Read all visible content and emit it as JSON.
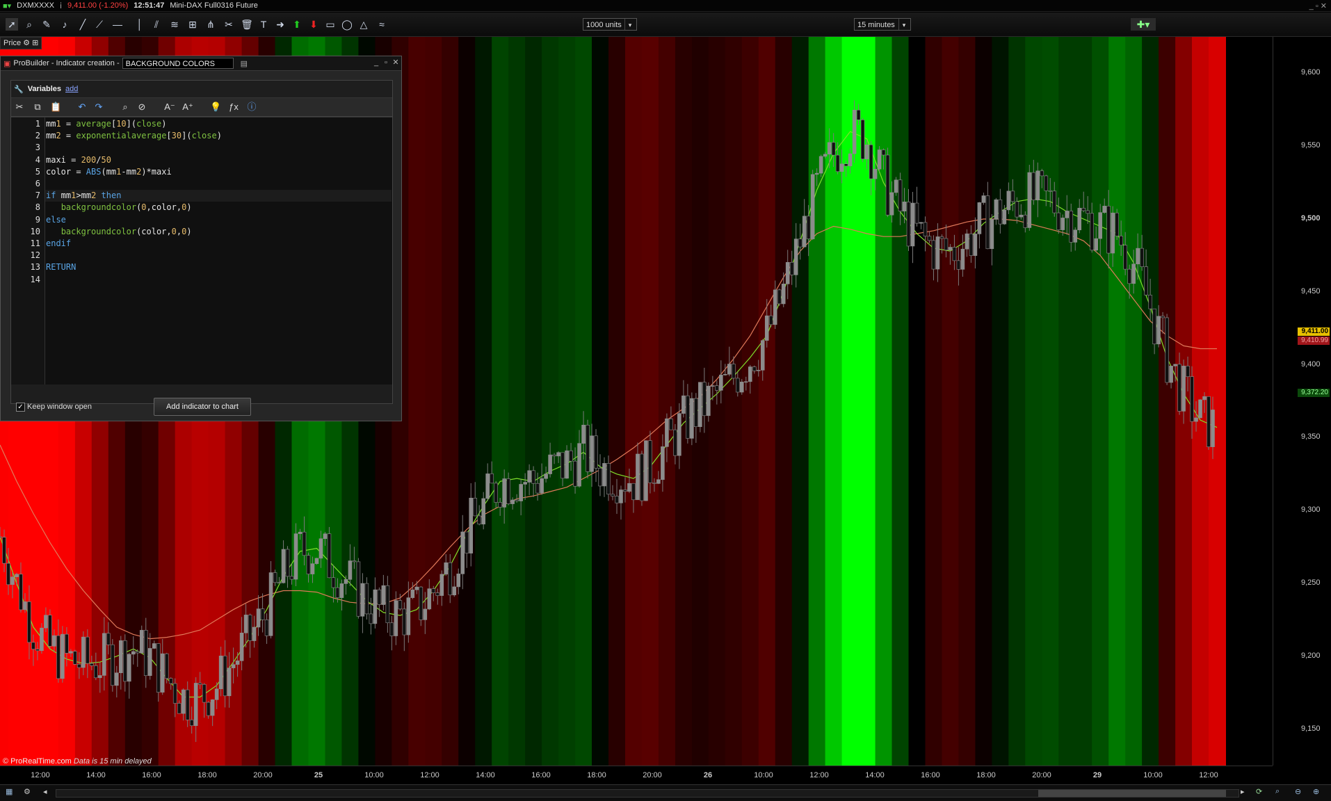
{
  "topbar": {
    "symbol": "DXMXXXX",
    "price": "9,411.00 (-1.20%)",
    "time": "12:51:47",
    "instrument": "Mini-DAX Full0316 Future"
  },
  "toolbar": {
    "units_select": "1000 units",
    "timeframe_select": "15 minutes"
  },
  "price_tab": "Price",
  "probuilder": {
    "title": "ProBuilder - Indicator creation  -",
    "indicator_name": "BACKGROUND COLORS",
    "variables_label": "Variables",
    "add_link": "add",
    "keep_open_label": "Keep window open",
    "add_button": "Add indicator to chart",
    "code_lines": [
      "mm1 = average[10](close)",
      "mm2 = exponentialaverage[30](close)",
      "",
      "maxi = 200/50",
      "color = ABS(mm1-mm2)*maxi",
      "",
      "if mm1>mm2 then",
      "   backgroundcolor(0,color,0)",
      "else",
      "   backgroundcolor(color,0,0)",
      "endif",
      "",
      "RETURN",
      ""
    ]
  },
  "y_axis": {
    "labels": [
      "9,600",
      "9,550",
      "9,500",
      "9,450",
      "9,400",
      "9,350",
      "9,300",
      "9,250",
      "9,200",
      "9,150"
    ],
    "tag_last": "9,411.00",
    "tag_mm2": "9,410.99",
    "tag_mm1": "9,372.20"
  },
  "x_axis": {
    "labels": [
      {
        "t": "12:00",
        "bold": false
      },
      {
        "t": "14:00",
        "bold": false
      },
      {
        "t": "16:00",
        "bold": false
      },
      {
        "t": "18:00",
        "bold": false
      },
      {
        "t": "20:00",
        "bold": false
      },
      {
        "t": "25",
        "bold": true
      },
      {
        "t": "10:00",
        "bold": false
      },
      {
        "t": "12:00",
        "bold": false
      },
      {
        "t": "14:00",
        "bold": false
      },
      {
        "t": "16:00",
        "bold": false
      },
      {
        "t": "18:00",
        "bold": false
      },
      {
        "t": "20:00",
        "bold": false
      },
      {
        "t": "26",
        "bold": true
      },
      {
        "t": "10:00",
        "bold": false
      },
      {
        "t": "12:00",
        "bold": false
      },
      {
        "t": "14:00",
        "bold": false
      },
      {
        "t": "16:00",
        "bold": false
      },
      {
        "t": "18:00",
        "bold": false
      },
      {
        "t": "20:00",
        "bold": false
      },
      {
        "t": "29",
        "bold": true
      },
      {
        "t": "10:00",
        "bold": false
      },
      {
        "t": "12:00",
        "bold": false
      }
    ]
  },
  "credit": "© ProRealTime.com",
  "credit_note": "Data is 15 min delayed",
  "chart_data": {
    "type": "candlestick",
    "ylim": [
      9125,
      9625
    ],
    "series": [
      {
        "name": "mm1",
        "values": [
          9282,
          9250,
          9220,
          9205,
          9198,
          9195,
          9196,
          9200,
          9205,
          9199,
          9185,
          9172,
          9172,
          9180,
          9196,
          9213,
          9232,
          9255,
          9272,
          9274,
          9262,
          9250,
          9238,
          9230,
          9228,
          9232,
          9245,
          9262,
          9284,
          9303,
          9320,
          9322,
          9320,
          9327,
          9332,
          9340,
          9330,
          9325,
          9322,
          9330,
          9345,
          9360,
          9370,
          9380,
          9392,
          9405,
          9420,
          9450,
          9485,
          9520,
          9545,
          9560,
          9555,
          9525,
          9505,
          9490,
          9480,
          9478,
          9485,
          9497,
          9505,
          9512,
          9514,
          9512,
          9505,
          9500,
          9495,
          9490,
          9470,
          9440,
          9405,
          9380,
          9362,
          9357,
          9360,
          9372
        ]
      },
      {
        "name": "mm2",
        "values": [
          9345,
          9320,
          9298,
          9278,
          9260,
          9245,
          9232,
          9220,
          9215,
          9212,
          9213,
          9215,
          9218,
          9225,
          9232,
          9238,
          9242,
          9245,
          9245,
          9244,
          9240,
          9237,
          9236,
          9236,
          9240,
          9250,
          9262,
          9275,
          9287,
          9297,
          9303,
          9308,
          9310,
          9313,
          9316,
          9322,
          9328,
          9335,
          9343,
          9352,
          9362,
          9370,
          9378,
          9390,
          9404,
          9420,
          9440,
          9460,
          9478,
          9490,
          9495,
          9493,
          9490,
          9488,
          9488,
          9490,
          9492,
          9495,
          9498,
          9500,
          9500,
          9499,
          9496,
          9493,
          9490,
          9485,
          9475,
          9460,
          9445,
          9430,
          9420,
          9413,
          9411,
          9411
        ]
      }
    ],
    "candles_ohlc_sample": [
      [
        9238,
        9250,
        9215,
        9228
      ],
      [
        9560,
        9575,
        9545,
        9550
      ],
      [
        9411,
        9420,
        9395,
        9411
      ]
    ],
    "last_price": 9411.0,
    "background": "per-bar color: green intensity when mm1>mm2, red intensity otherwise"
  },
  "colors": {
    "up_candle": "#8c8c8c",
    "down_candle": "#111111",
    "mm1": "#7fe02a",
    "mm2": "#e07a5a",
    "tag_last_bg": "#e8c000"
  }
}
